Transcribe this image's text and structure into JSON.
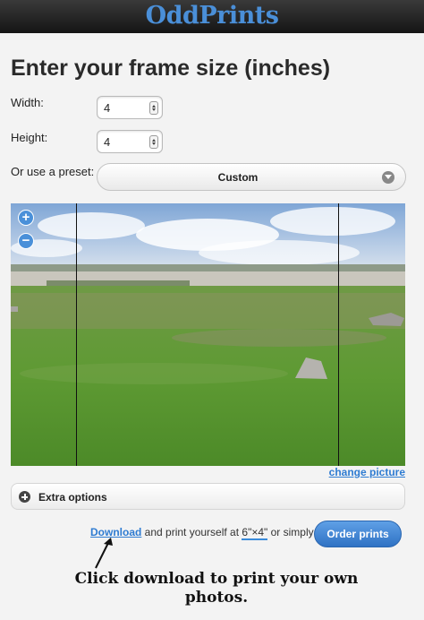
{
  "header": {
    "logo_text": "OddPrints"
  },
  "main": {
    "title": "Enter your frame size (inches)",
    "width": {
      "label": "Width:",
      "value": "4"
    },
    "height": {
      "label": "Height:",
      "value": "4"
    },
    "preset": {
      "label": "Or use a preset:",
      "selected": "Custom"
    },
    "photo": {
      "zoom_in": "+",
      "zoom_out": "−",
      "change_link": "change picture"
    },
    "extra_options": {
      "label": "Extra options"
    },
    "download_line": {
      "link": "Download",
      "text_before_size": " and print yourself at ",
      "size": "6\"×4\"",
      "text_after_size": " or simply"
    },
    "order_button": "Order prints"
  },
  "annotation": {
    "caption": "Click download to print your own photos."
  },
  "colors": {
    "accent": "#2f7cd2",
    "logo": "#4a8fd8",
    "header_bg": "#1f1f1f"
  }
}
